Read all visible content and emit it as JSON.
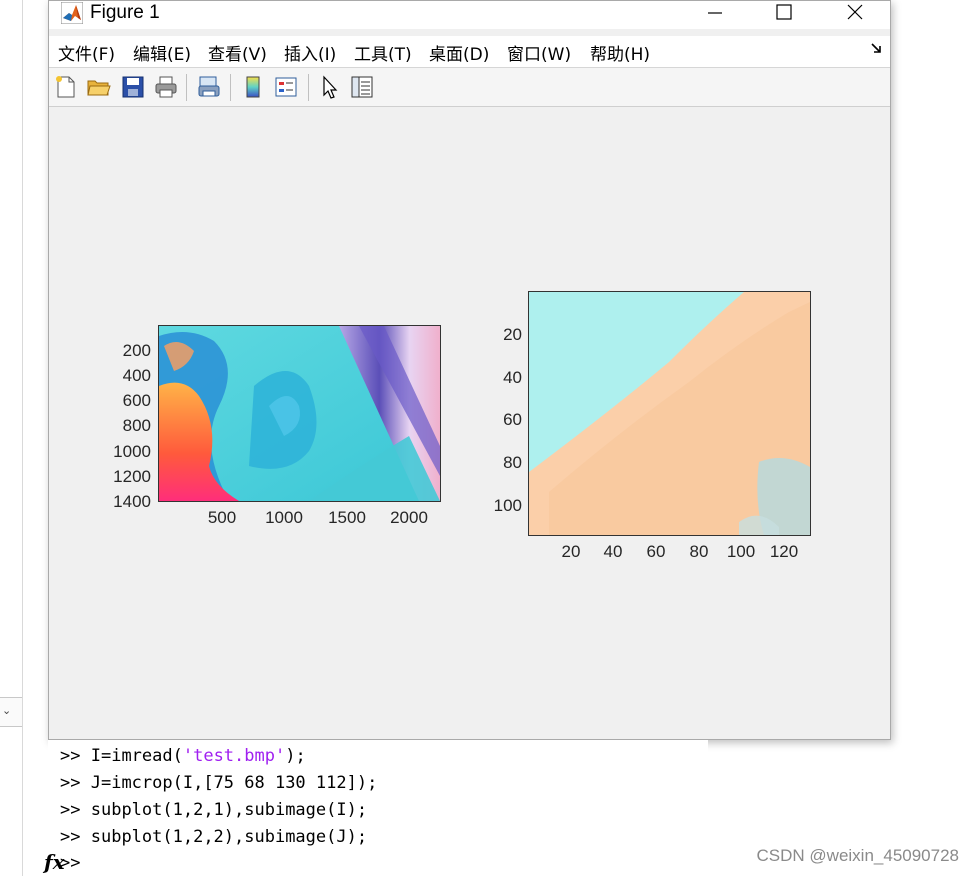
{
  "window": {
    "title": "Figure 1"
  },
  "menu": [
    {
      "label": "文件(F)"
    },
    {
      "label": "编辑(E)"
    },
    {
      "label": "查看(V)"
    },
    {
      "label": "插入(I)"
    },
    {
      "label": "工具(T)"
    },
    {
      "label": "桌面(D)"
    },
    {
      "label": "窗口(W)"
    },
    {
      "label": "帮助(H)"
    }
  ],
  "toolbar": [
    "new-figure-icon",
    "open-folder-icon",
    "save-icon",
    "print-icon",
    "link-figure-icon",
    "colorbar-icon",
    "legend-icon",
    "pointer-icon",
    "property-inspector-icon"
  ],
  "plots": [
    {
      "name": "subplot-1",
      "yticks": [
        "200",
        "400",
        "600",
        "800",
        "1000",
        "1200",
        "1400"
      ],
      "xticks": [
        "500",
        "1000",
        "1500",
        "2000"
      ]
    },
    {
      "name": "subplot-2",
      "yticks": [
        "20",
        "40",
        "60",
        "80",
        "100"
      ],
      "xticks": [
        "20",
        "40",
        "60",
        "80",
        "100",
        "120"
      ]
    }
  ],
  "command_window": {
    "prompt": ">>",
    "lines": [
      {
        "pre": "I=imread(",
        "str": "'test.bmp'",
        "post": ");"
      },
      {
        "pre": "J=imcrop(I,[75 68 130 112]);",
        "str": "",
        "post": ""
      },
      {
        "pre": "subplot(1,2,1),subimage(I);",
        "str": "",
        "post": ""
      },
      {
        "pre": "subplot(1,2,2),subimage(J);",
        "str": "",
        "post": ""
      }
    ],
    "fx_label": "fx"
  },
  "watermark": "CSDN @weixin_45090728"
}
